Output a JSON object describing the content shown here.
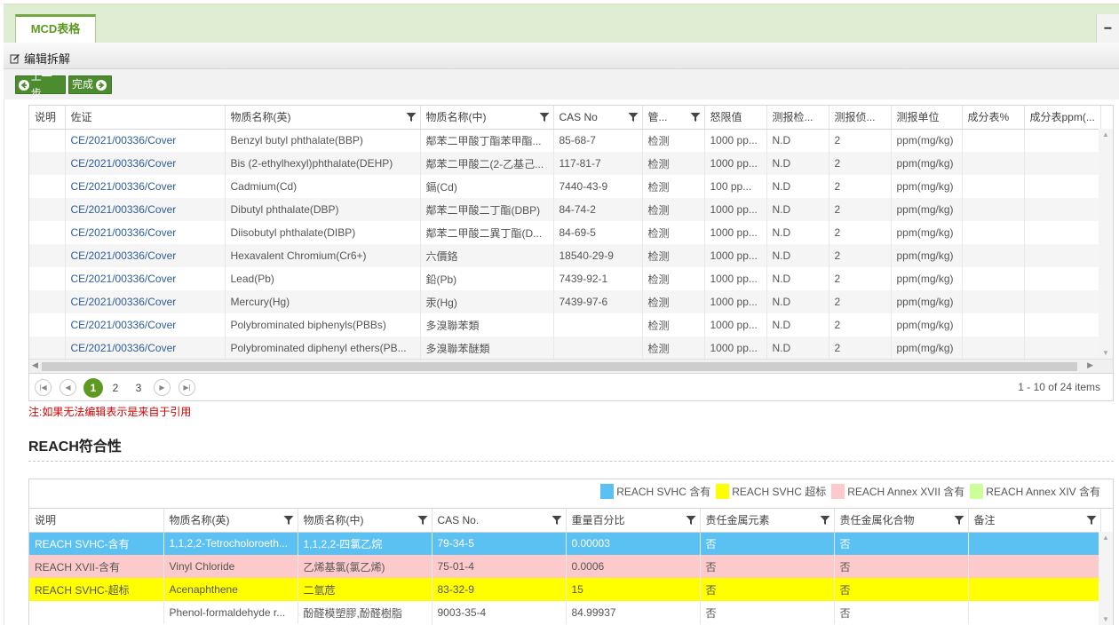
{
  "tab": {
    "label": "MCD表格"
  },
  "collapse_label": "−",
  "toolbar": {
    "edit_split_label": "编辑拆解"
  },
  "nav": {
    "prev_label": "上一步",
    "done_label": "完成"
  },
  "grid1": {
    "columns": [
      "说明",
      "佐证",
      "物质名称(英)",
      "物质名称(中)",
      "CAS No",
      "管...",
      "怒限值",
      "测报检...",
      "测报侦...",
      "测报单位",
      "成分表%",
      "成分表ppm(..."
    ],
    "rows": [
      [
        "",
        "CE/2021/00336/Cover",
        "Benzyl butyl phthalate(BBP)",
        "鄰苯二甲酸丁酯苯甲酯...",
        "85-68-7",
        "检测",
        "1000 pp...",
        "N.D",
        "2",
        "ppm(mg/kg)",
        "",
        ""
      ],
      [
        "",
        "CE/2021/00336/Cover",
        "Bis (2-ethylhexyl)phthalate(DEHP)",
        "鄰苯二甲酸二(2-乙基己...",
        "117-81-7",
        "检测",
        "1000 pp...",
        "N.D",
        "2",
        "ppm(mg/kg)",
        "",
        ""
      ],
      [
        "",
        "CE/2021/00336/Cover",
        "Cadmium(Cd)",
        "鎘(Cd)",
        "7440-43-9",
        "检测",
        "100 pp...",
        "N.D",
        "2",
        "ppm(mg/kg)",
        "",
        ""
      ],
      [
        "",
        "CE/2021/00336/Cover",
        "Dibutyl phthalate(DBP)",
        "鄰苯二甲酸二丁酯(DBP)",
        "84-74-2",
        "检测",
        "1000 pp...",
        "N.D",
        "2",
        "ppm(mg/kg)",
        "",
        ""
      ],
      [
        "",
        "CE/2021/00336/Cover",
        "Diisobutyl phthalate(DIBP)",
        "鄰苯二甲酸二異丁酯(D...",
        "84-69-5",
        "检测",
        "1000 pp...",
        "N.D",
        "2",
        "ppm(mg/kg)",
        "",
        ""
      ],
      [
        "",
        "CE/2021/00336/Cover",
        "Hexavalent Chromium(Cr6+)",
        "六價鉻",
        "18540-29-9",
        "检测",
        "1000 pp...",
        "N.D",
        "2",
        "ppm(mg/kg)",
        "",
        ""
      ],
      [
        "",
        "CE/2021/00336/Cover",
        "Lead(Pb)",
        "鉛(Pb)",
        "7439-92-1",
        "检测",
        "1000 pp...",
        "N.D",
        "2",
        "ppm(mg/kg)",
        "",
        ""
      ],
      [
        "",
        "CE/2021/00336/Cover",
        "Mercury(Hg)",
        "汞(Hg)",
        "7439-97-6",
        "检测",
        "1000 pp...",
        "N.D",
        "2",
        "ppm(mg/kg)",
        "",
        ""
      ],
      [
        "",
        "CE/2021/00336/Cover",
        "Polybrominated biphenyls(PBBs)",
        "多溴聯苯類",
        "",
        "检测",
        "1000 pp...",
        "N.D",
        "2",
        "ppm(mg/kg)",
        "",
        ""
      ],
      [
        "",
        "CE/2021/00336/Cover",
        "Polybrominated diphenyl ethers(PB...",
        "多溴聯苯醚類",
        "",
        "检测",
        "1000 pp...",
        "N.D",
        "2",
        "ppm(mg/kg)",
        "",
        ""
      ]
    ]
  },
  "pager": {
    "pages": [
      "1",
      "2",
      "3"
    ],
    "info": "1 - 10 of 24 items"
  },
  "note": "注:如果无法编辑表示是来自于引用",
  "reach": {
    "title": "REACH符合性",
    "legend": [
      {
        "label": "REACH SVHC 含有",
        "color": "#5bc0f2"
      },
      {
        "label": "REACH SVHC 超标",
        "color": "#ffff00"
      },
      {
        "label": "REACH Annex XVII 含有",
        "color": "#fccacb"
      },
      {
        "label": "REACH Annex XIV 含有",
        "color": "#ccff99"
      }
    ],
    "columns": [
      "说明",
      "物质名称(英)",
      "物质名称(中)",
      "CAS No.",
      "重量百分比",
      "责任金属元素",
      "责任金属化合物",
      "备注"
    ],
    "rows": [
      [
        "REACH SVHC-含有",
        "1,1,2,2-Tetrocholoroeth...",
        "1,1,2,2-四氯乙烷",
        "79-34-5",
        "0.00003",
        "否",
        "否",
        ""
      ],
      [
        "REACH XVII-含有",
        "Vinyl Chloride",
        "乙烯基氯(氯乙烯)",
        "75-01-4",
        "0.0006",
        "否",
        "否",
        ""
      ],
      [
        "REACH SVHC-超标",
        "Acenaphthene",
        "二氫苊",
        "83-32-9",
        "15",
        "否",
        "否",
        ""
      ],
      [
        "",
        "Phenol-formaldehyde r...",
        "酚醛模塑膠,酚醛樹脂",
        "9003-35-4",
        "84.99937",
        "否",
        "否",
        ""
      ]
    ]
  }
}
